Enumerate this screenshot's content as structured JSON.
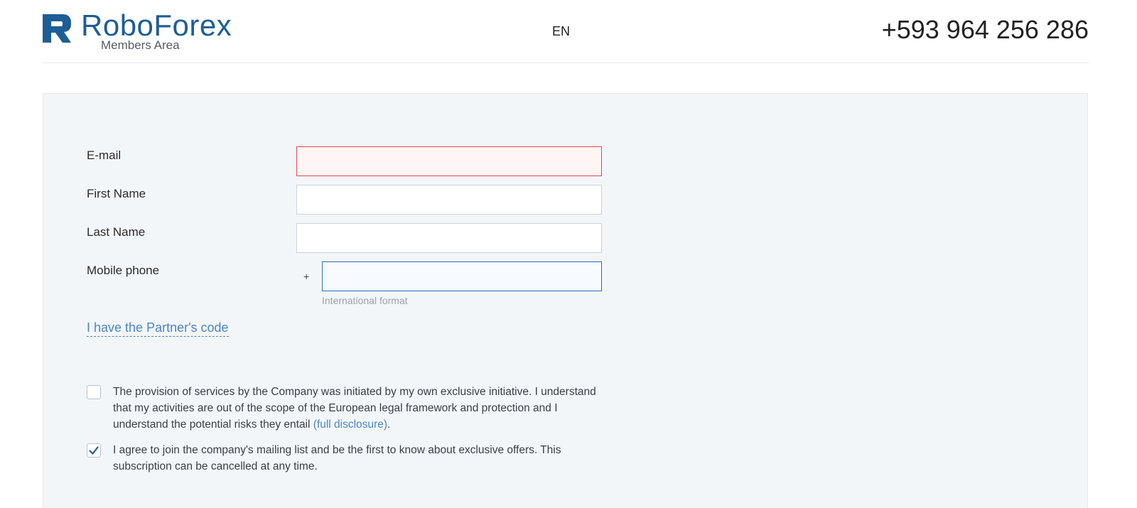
{
  "header": {
    "logo_text": "RoboForex",
    "logo_subtitle": "Members Area",
    "language": "EN",
    "phone": "+593 964 256 286"
  },
  "form": {
    "email": {
      "label": "E-mail",
      "value": "",
      "state": "error"
    },
    "first_name": {
      "label": "First Name",
      "value": ""
    },
    "last_name": {
      "label": "Last Name",
      "value": ""
    },
    "mobile_phone": {
      "label": "Mobile phone",
      "prefix": "+",
      "value": "",
      "hint": "International format",
      "state": "focused"
    },
    "partner_code_link": "I have the Partner's code",
    "consents": [
      {
        "checked": false,
        "text": "The provision of services by the Company was initiated by my own exclusive initiative. I understand that my activities are out of the scope of the European legal framework and protection and I understand the potential risks they entail ",
        "link_text": "(full disclosure)",
        "after_link": "."
      },
      {
        "checked": true,
        "text": "I agree to join the company's mailing list and be the first to know about exclusive offers. This subscription can be cancelled at any time."
      }
    ]
  },
  "colors": {
    "brand": "#1d5e96",
    "link": "#4a86c8",
    "error_border": "#e5484d",
    "focus_border": "#2e6bb6",
    "panel_bg": "#f3f6f9"
  },
  "icons": {
    "logo": "roboforex-logo-icon",
    "checkmark": "checkmark-icon"
  }
}
